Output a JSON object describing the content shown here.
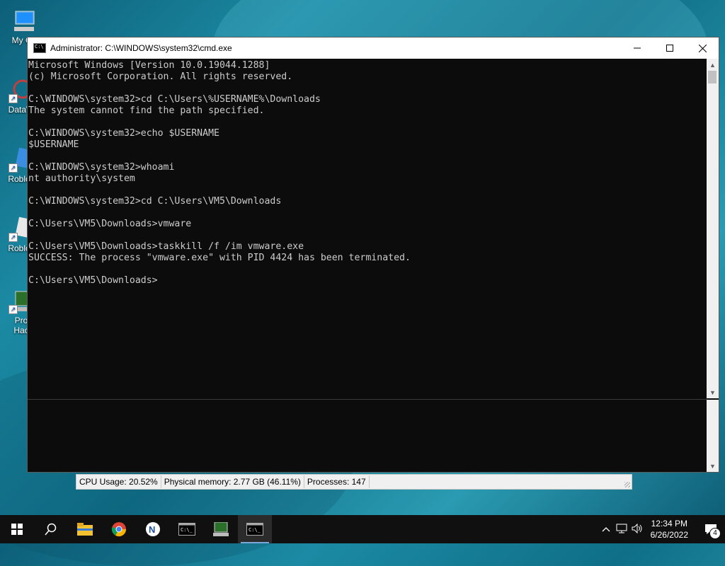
{
  "desktop": {
    "icons": [
      {
        "name": "my-computer-icon",
        "label": "My Co"
      },
      {
        "name": "dataw-icon",
        "label": "DataW"
      },
      {
        "name": "roblox-icon",
        "label": "Roblox"
      },
      {
        "name": "roblox-2-icon",
        "label": "Roblox"
      },
      {
        "name": "pro-hac-icon",
        "label": "Pro\nHac"
      }
    ]
  },
  "window": {
    "title": "Administrator: C:\\WINDOWS\\system32\\cmd.exe",
    "controls": {
      "minimize": "—",
      "maximize": "☐",
      "close": "✕"
    }
  },
  "console": {
    "lines": [
      "Microsoft Windows [Version 10.0.19044.1288]",
      "(c) Microsoft Corporation. All rights reserved.",
      "",
      "C:\\WINDOWS\\system32>cd C:\\Users\\%USERNAME%\\Downloads",
      "The system cannot find the path specified.",
      "",
      "C:\\WINDOWS\\system32>echo $USERNAME",
      "$USERNAME",
      "",
      "C:\\WINDOWS\\system32>whoami",
      "nt authority\\system",
      "",
      "C:\\WINDOWS\\system32>cd C:\\Users\\VM5\\Downloads",
      "",
      "C:\\Users\\VM5\\Downloads>vmware",
      "",
      "C:\\Users\\VM5\\Downloads>taskkill /f /im vmware.exe",
      "SUCCESS: The process \"vmware.exe\" with PID 4424 has been terminated.",
      "",
      "C:\\Users\\VM5\\Downloads>"
    ]
  },
  "statusbar": {
    "cpu": "CPU Usage: 20.52%",
    "memory": "Physical memory: 2.77 GB (46.11%)",
    "processes": "Processes: 147"
  },
  "taskbar": {
    "apps": [
      "start-icon",
      "search-icon",
      "file-explorer-icon",
      "chrome-icon",
      "app-icon",
      "cmd-icon",
      "process-hacker-icon",
      "cmd-active-icon"
    ],
    "clock": {
      "time": "12:34 PM",
      "date": "6/26/2022"
    },
    "notifications": "4"
  },
  "colors": {
    "console_bg": "#0c0c0c",
    "console_text": "#cccccc",
    "taskbar_bg": "#101010"
  }
}
